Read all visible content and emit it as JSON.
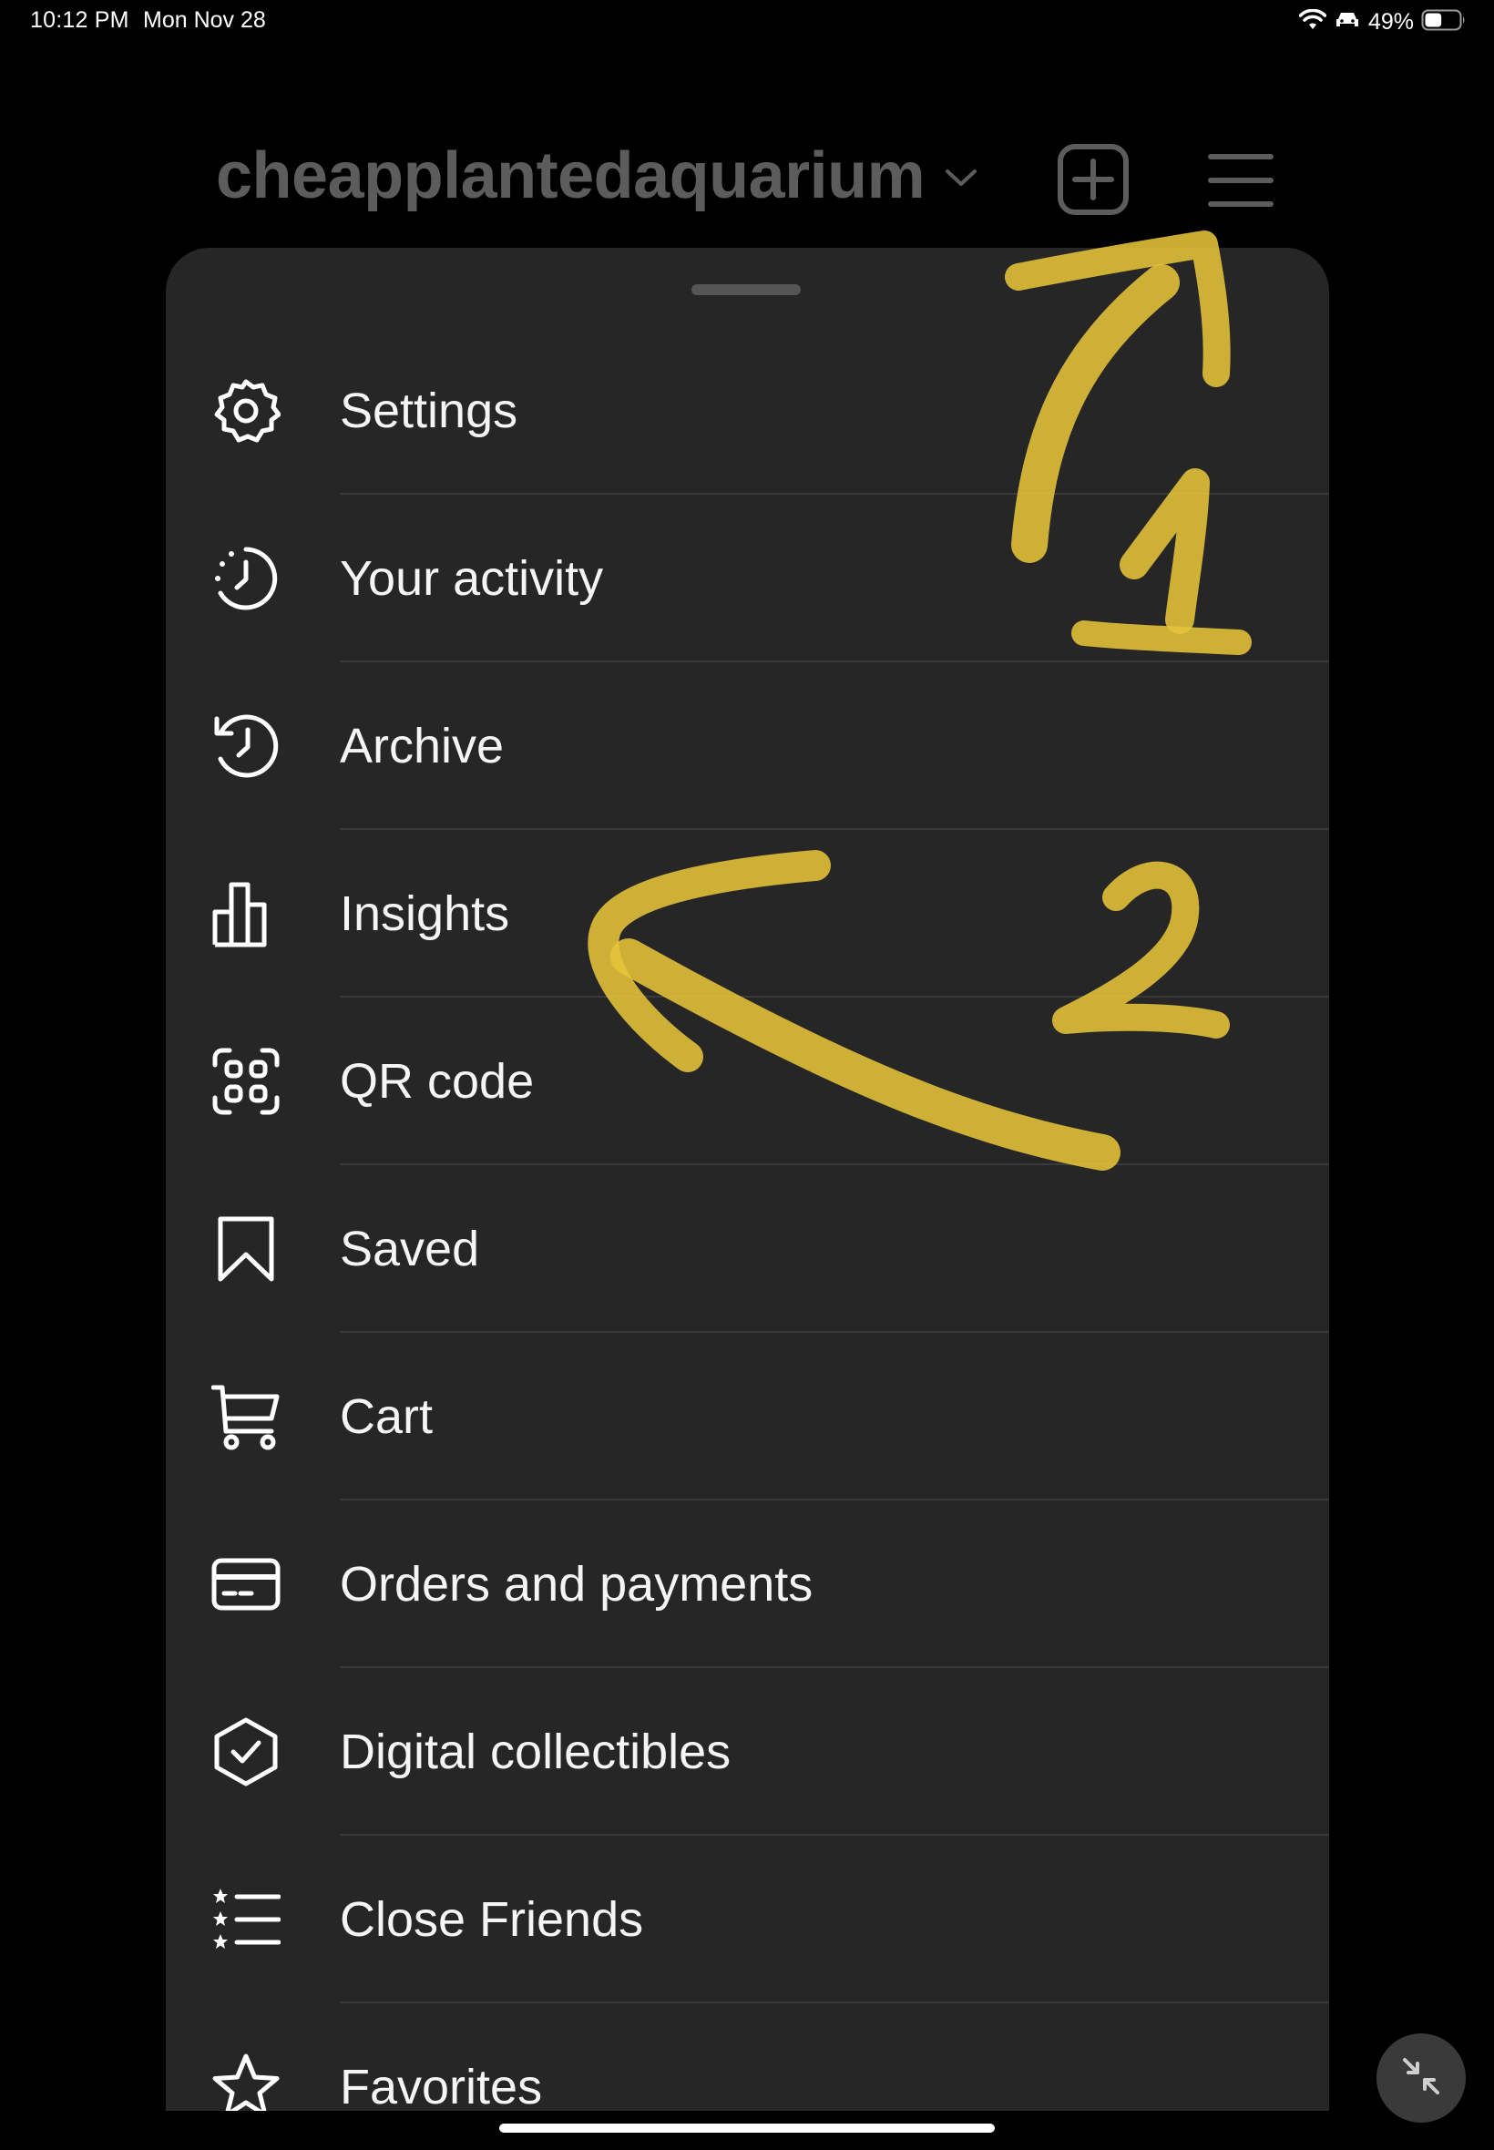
{
  "status_bar": {
    "time": "10:12 PM",
    "date": "Mon Nov 28",
    "battery_percent": "49%",
    "battery_level": 0.49,
    "icons": [
      "wifi-icon",
      "car-icon",
      "battery-icon"
    ]
  },
  "header": {
    "username": "cheapplantedaquarium",
    "icons": [
      "chevron-down-icon",
      "new-post-icon",
      "hamburger-menu-icon"
    ]
  },
  "menu": {
    "items": [
      {
        "label": "Settings",
        "icon": "gear-icon"
      },
      {
        "label": "Your activity",
        "icon": "activity-clock-icon"
      },
      {
        "label": "Archive",
        "icon": "archive-history-icon"
      },
      {
        "label": "Insights",
        "icon": "bar-chart-icon"
      },
      {
        "label": "QR code",
        "icon": "qr-code-icon"
      },
      {
        "label": "Saved",
        "icon": "bookmark-icon"
      },
      {
        "label": "Cart",
        "icon": "cart-icon"
      },
      {
        "label": "Orders and payments",
        "icon": "credit-card-icon"
      },
      {
        "label": "Digital collectibles",
        "icon": "verified-badge-icon"
      },
      {
        "label": "Close Friends",
        "icon": "starred-list-icon"
      },
      {
        "label": "Favorites",
        "icon": "star-icon"
      }
    ]
  },
  "annotations": {
    "color": "#e6c43a",
    "marks": [
      {
        "label": "1",
        "points_to": "hamburger-menu-icon"
      },
      {
        "label": "2",
        "points_to": "Insights"
      }
    ]
  },
  "colors": {
    "background": "#000000",
    "sheet": "#262626",
    "text": "#f5f5f5",
    "username_dimmed": "#5c5c5c",
    "annotation": "#e6c43a"
  }
}
